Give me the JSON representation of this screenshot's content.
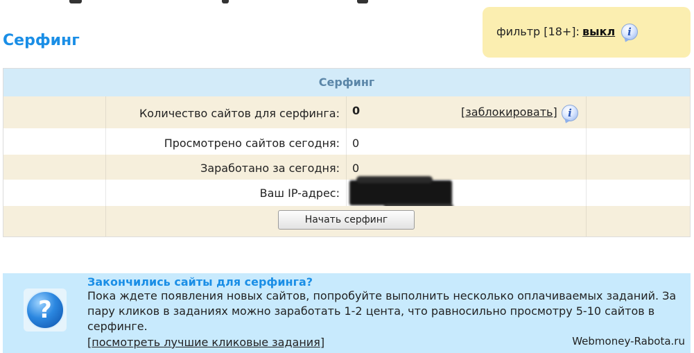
{
  "page": {
    "title": "Серфинг"
  },
  "filter": {
    "label": "фильтр [18+]:",
    "toggle": "выкл"
  },
  "surf_panel": {
    "header": "Серфинг",
    "rows": [
      {
        "label": "Количество сайтов для серфинга:",
        "value": "0",
        "action_open": "[",
        "action": "заблокировать",
        "action_close": "]"
      },
      {
        "label": "Просмотрено сайтов сегодня:",
        "value": "0"
      },
      {
        "label": "Заработано за сегодня:",
        "value": "0"
      },
      {
        "label": "Ваш IP-адрес:",
        "value": ""
      }
    ],
    "start_button": "Начать серфинг"
  },
  "help": {
    "title": "Закончились сайты для серфинга?",
    "text": "Пока ждете появления новых сайтов, попробуйте выполнить несколько оплачиваемых заданий. За пару кликов в заданиях можно заработать 1-2 цента, что равносильно просмотру 5-10 сайтов в серфинге.",
    "link_open": "[",
    "link": "посмотреть лучшие кликовые задания",
    "link_close": "]"
  },
  "watermark": "Webmoney-Rabota.ru",
  "icons": {
    "info": "info-icon",
    "help": "question-icon"
  },
  "colors": {
    "title_blue": "#1a8ee6",
    "filter_bg": "#fbeeb0",
    "panel_header_bg": "#d3ebf9",
    "row_beige": "#f6efdc",
    "help_bg": "#c8eafd"
  }
}
